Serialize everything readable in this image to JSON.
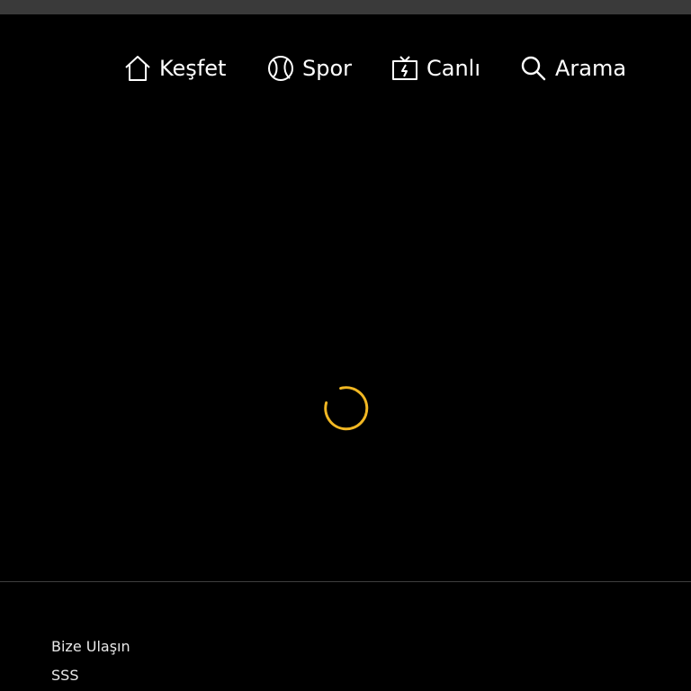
{
  "colors": {
    "background": "#000000",
    "topbar": "#3a3a3a",
    "nav_text": "#ffffff",
    "spinner_accent": "#f2b823",
    "divider": "#3f3f3f",
    "footer_text": "#e9e9e9"
  },
  "nav": {
    "items": [
      {
        "label": "Keşfet",
        "icon": "home-icon"
      },
      {
        "label": "Spor",
        "icon": "ball-icon"
      },
      {
        "label": "Canlı",
        "icon": "live-tv-icon"
      },
      {
        "label": "Arama",
        "icon": "search-icon"
      }
    ]
  },
  "main": {
    "loading_indicator": "spinner"
  },
  "footer": {
    "links": [
      {
        "label": "Bize Ulaşın"
      },
      {
        "label": "SSS"
      }
    ]
  }
}
